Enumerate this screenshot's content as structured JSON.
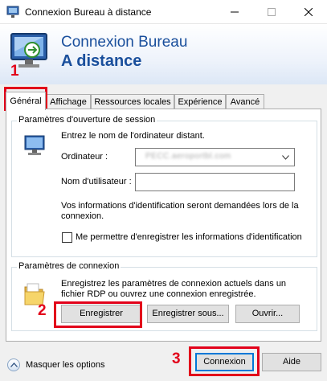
{
  "window": {
    "title": "Connexion Bureau à distance"
  },
  "banner": {
    "line1": "Connexion Bureau",
    "line2": "A distance"
  },
  "annotations": {
    "step1": "1",
    "step2": "2",
    "step3": "3",
    "color": "#e2001a"
  },
  "tabs": [
    {
      "label": "Général",
      "active": true
    },
    {
      "label": "Affichage",
      "active": false
    },
    {
      "label": "Ressources locales",
      "active": false
    },
    {
      "label": "Expérience",
      "active": false
    },
    {
      "label": "Avancé",
      "active": false
    }
  ],
  "logon_group": {
    "title": "Paramètres d'ouverture de session",
    "prompt": "Entrez le nom de l'ordinateur distant.",
    "computer_label": "Ordinateur :",
    "computer_value": "PECC.aeroportbl.com",
    "username_label": "Nom d'utilisateur :",
    "username_value": "",
    "info_text": "Vos informations d'identification seront demandées lors de la connexion.",
    "remember_label": "Me permettre d'enregistrer les informations d'identification",
    "remember_checked": false
  },
  "connection_group": {
    "title": "Paramètres de connexion",
    "description": "Enregistrez les paramètres de connexion actuels dans un fichier RDP ou ouvrez une connexion enregistrée.",
    "save_label": "Enregistrer",
    "save_as_label": "Enregistrer sous...",
    "open_label": "Ouvrir..."
  },
  "footer": {
    "hide_options_label": "Masquer les options",
    "connect_label": "Connexion",
    "help_label": "Aide"
  }
}
